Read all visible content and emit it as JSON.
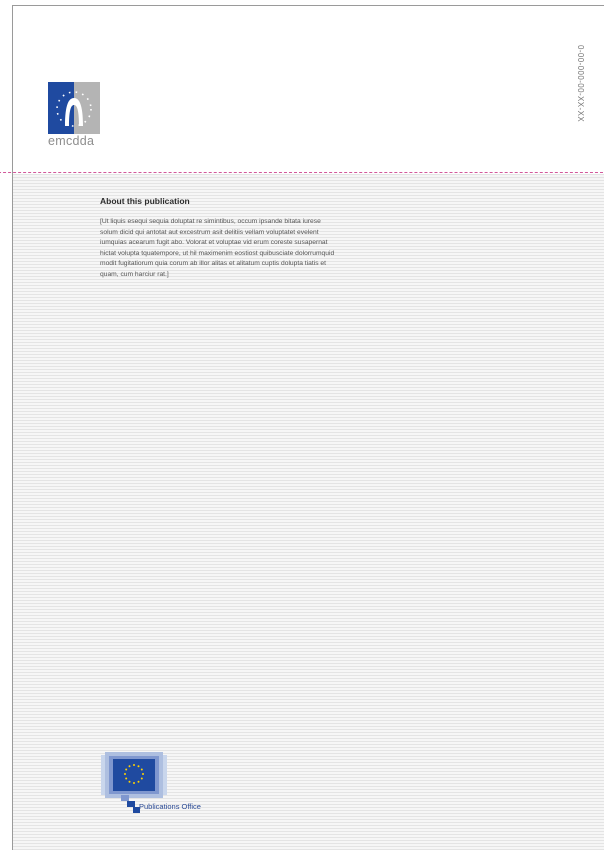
{
  "header": {
    "brand_word": "emcdda",
    "isbn": "0-00-000-00-XX-XX"
  },
  "about": {
    "title": "About this publication",
    "body": "[Ut liquis esequi sequia doluptat re simintibus, occum ipsande bitata iurese solum dicid qui antotat aut excestrum asit delitiis vellam voluptatet evelent iumquias acearum fugit abo. Volorat et voluptae vid erum coreste susapernat hictat volupta tquatempore, ut hil maximenim eostiost quibusciate dolorrumquid modit fugitatiorum quia corum ab illor alitas et alitatum cuptis dolupta tiatis et quam, cum harciur rat.]"
  },
  "footer": {
    "publisher": "Publications Office"
  },
  "icons": {
    "emcdda_logo": "emcdda-logo-icon",
    "publications_office_logo": "eu-flag-speech-bubble-icon"
  },
  "colors": {
    "eu_blue": "#1f4aa0",
    "eu_gold": "#ffd200",
    "trim_line": "#d2589a",
    "publisher_text": "#2a4a95"
  }
}
